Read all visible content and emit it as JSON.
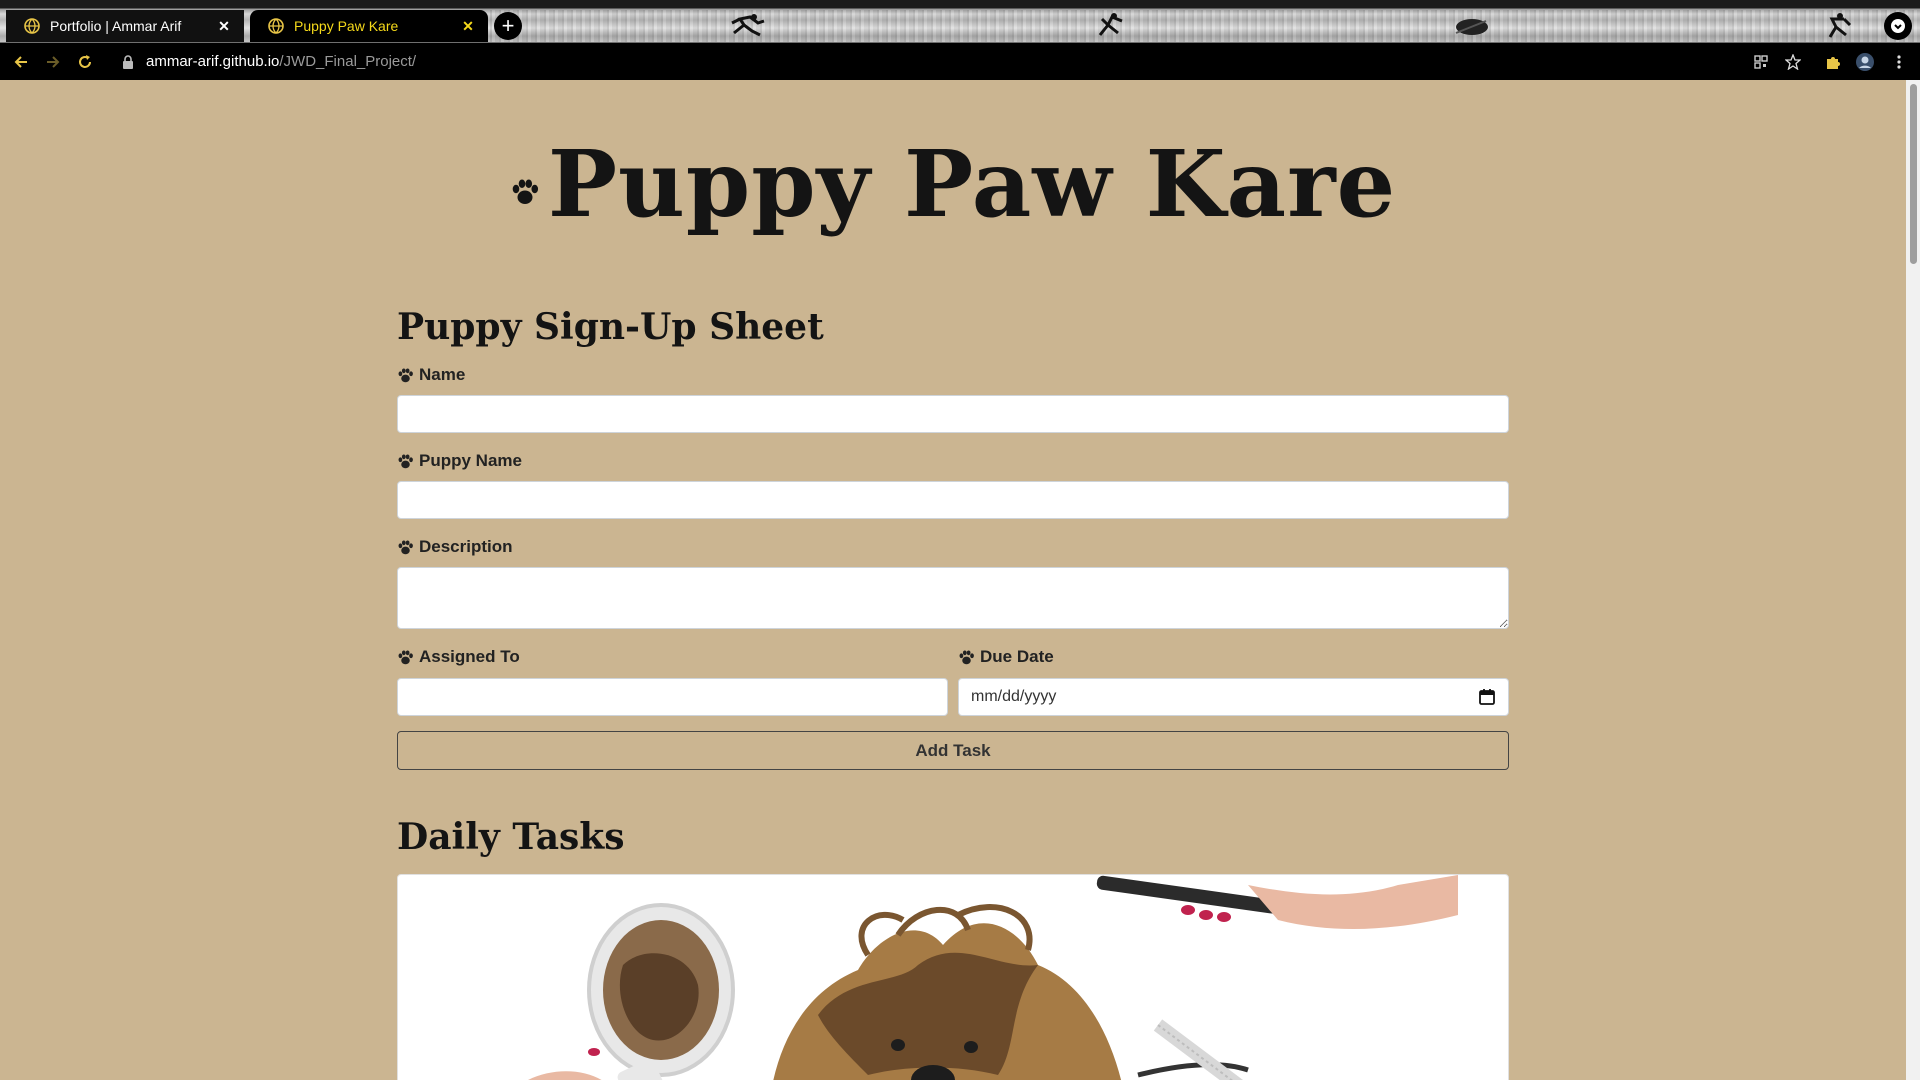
{
  "browser": {
    "tabs": [
      {
        "title": "Portfolio | Ammar Arif",
        "active": false
      },
      {
        "title": "Puppy Paw Kare",
        "active": true
      }
    ],
    "new_tab_label": "+",
    "url": {
      "host": "ammar-arif.github.io",
      "path": "/JWD_Final_Project/"
    },
    "colors": {
      "active_tab_text": "#f5d91a",
      "toolbar": "#000000"
    }
  },
  "page": {
    "site_title": "Puppy Paw Kare",
    "signup_heading": "Puppy Sign-Up Sheet",
    "form": {
      "name_label": "Name",
      "puppy_name_label": "Puppy Name",
      "description_label": "Description",
      "assigned_to_label": "Assigned To",
      "due_date_label": "Due Date",
      "due_date_placeholder": "mm/dd/yyyy",
      "submit_label": "Add Task"
    },
    "daily_heading": "Daily Tasks",
    "colors": {
      "background": "#cbb591",
      "heading": "#141414"
    }
  }
}
